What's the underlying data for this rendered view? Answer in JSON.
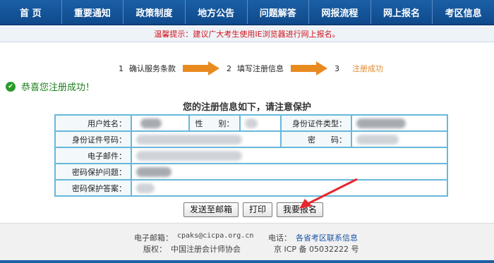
{
  "nav": {
    "items": [
      "首 页",
      "重要通知",
      "政策制度",
      "地方公告",
      "问题解答",
      "网报流程",
      "网上报名",
      "考区信息"
    ]
  },
  "notice": "温馨提示：建议广大考生使用IE浏览器进行网上报名。",
  "steps": [
    {
      "num": "1",
      "label": "确认服务条款"
    },
    {
      "num": "2",
      "label": "填写注册信息"
    },
    {
      "num": "3",
      "label": "注册成功"
    }
  ],
  "success_text": "恭喜您注册成功！",
  "section_title": "您的注册信息如下，请注意保护",
  "table": {
    "name_label": "用户姓名：",
    "gender_label": "性　　别：",
    "idtype_label": "身份证件类型：",
    "idnum_label": "身份证件号码：",
    "password_label": "密　　码：",
    "email_label": "电子邮件：",
    "question_label": "密码保护问题：",
    "answer_label": "密码保护答案："
  },
  "buttons": {
    "send_email": "发送至邮箱",
    "print": "打印",
    "register": "我要报名"
  },
  "footer": {
    "email_label": "电子邮箱：",
    "email_value": "cpaks@cicpa.org.cn",
    "phone_label": "电话：",
    "phone_link": "各省考区联系信息",
    "copyright_label": "版权：",
    "copyright_value": "中国注册会计师协会",
    "icp": "京 ICP 备 05032222 号"
  },
  "colors": {
    "nav": "#1b5fa6",
    "notice_text": "#d0141b",
    "success": "#1d7f1d",
    "active_step": "#e08a2c",
    "table_border": "#67b8db",
    "arrow": "#e98a1f",
    "pointer": "#e8262e"
  }
}
